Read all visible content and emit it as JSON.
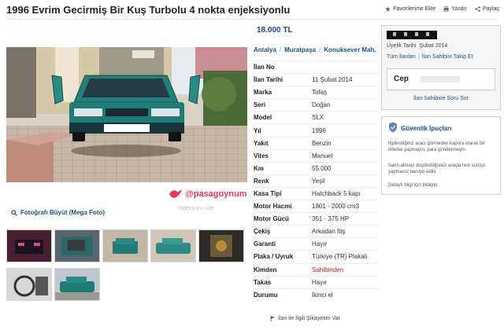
{
  "header": {
    "title": "1996 Evrim Gecirmiş Bir Kuş Turbolu 4 nokta enjeksiyonlu",
    "actions": [
      {
        "label": "Favorilerime Ekle",
        "icon": "star-icon"
      },
      {
        "label": "Yazdır",
        "icon": "printer-icon"
      },
      {
        "label": "Paylaş",
        "icon": "share-icon"
      }
    ]
  },
  "listing": {
    "price": "18.000 TL",
    "location": [
      "Antalya",
      "Muratpaşa",
      "Konuksever Mah."
    ],
    "location_sep": "/",
    "details": [
      {
        "key": "İlan No",
        "value": ""
      },
      {
        "key": "İlan Tarihi",
        "value": "11 Şubat 2014"
      },
      {
        "key": "Marka",
        "value": "Tofaş"
      },
      {
        "key": "Seri",
        "value": "Doğan"
      },
      {
        "key": "Model",
        "value": "SLX"
      },
      {
        "key": "Yıl",
        "value": "1996"
      },
      {
        "key": "Yakıt",
        "value": "Benzin"
      },
      {
        "key": "Vites",
        "value": "Manuel"
      },
      {
        "key": "Km",
        "value": "55.000"
      },
      {
        "key": "Renk",
        "value": "Yeşil"
      },
      {
        "key": "Kasa Tipi",
        "value": "Hatchback 5 kapı"
      },
      {
        "key": "Motor Hacmi",
        "value": "1801 - 2000 cm3"
      },
      {
        "key": "Motor Gücü",
        "value": "351 - 375 HP"
      },
      {
        "key": "Çekiş",
        "value": "Arkadan İtiş"
      },
      {
        "key": "Garanti",
        "value": "Hayır"
      },
      {
        "key": "Plaka / Uyruk",
        "value": "Türkiye (TR) Plakalı"
      },
      {
        "key": "Kimden",
        "value": "Sahibinden",
        "highlight": "#b21f2d"
      },
      {
        "key": "Takas",
        "value": "Hayır"
      },
      {
        "key": "Durumu",
        "value": "İkinci el"
      }
    ],
    "report_label": "İlan ile İlgili Şikayetim Var"
  },
  "gallery": {
    "enlarge_label": "Fotoğrafı Büyüt (Mega Foto)",
    "watermark": "@pasagoynum",
    "video_label": "Videosunu İzle",
    "thumb_count": 7
  },
  "seller": {
    "member_since_label": "Üyelik Tarihi",
    "member_since_value": "Şubat 2014",
    "all_listings": "Tüm İlanları",
    "follow": "İlan Sahibini Takip Et",
    "phone_label": "Cep",
    "ask_question": "İlan Sahibine Soru Sor"
  },
  "safety": {
    "title": "Güvenlik İpuçları",
    "p1": "İlgilendiğiniz aracı görmeden kapora olarak bir ödeme yapmayın, para göndermeyin.",
    "p2": "Satın almayı düşündüğünüz araçla test sürüşü yapmanız tavsiye edilir.",
    "more_text": "Detaylı bilgi için",
    "more_link": "tıklayın."
  },
  "colors": {
    "link": "#1c4f89",
    "price": "#1d4b86",
    "watermark": "#e03a5f",
    "car_body": "#1f7a78"
  }
}
